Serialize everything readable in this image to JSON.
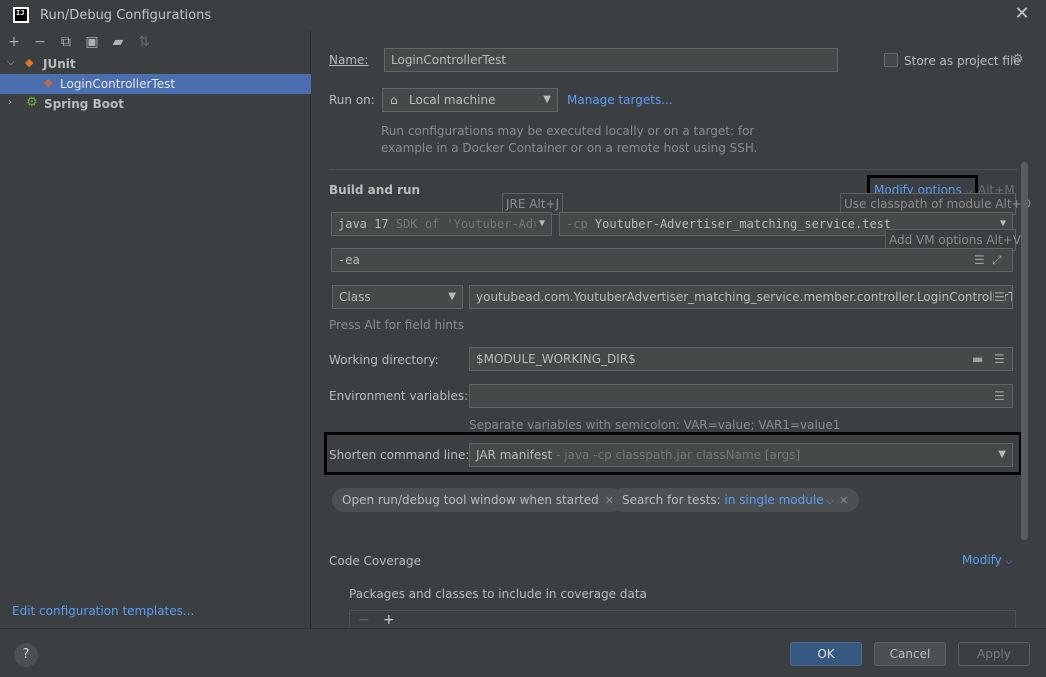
{
  "window": {
    "title": "Run/Debug Configurations",
    "app_icon_text": "IJ"
  },
  "sidebar": {
    "toolbar": [
      {
        "name": "add-icon",
        "glyph": "+"
      },
      {
        "name": "remove-icon",
        "glyph": "−"
      },
      {
        "name": "copy-icon",
        "glyph": "⧉"
      },
      {
        "name": "save-icon",
        "glyph": "▣"
      },
      {
        "name": "new-folder-icon",
        "glyph": "▰"
      },
      {
        "name": "sort-icon",
        "glyph": "⇅"
      }
    ],
    "tree": {
      "junit": {
        "label": "JUnit"
      },
      "login_test": {
        "label": "LoginControllerTest"
      },
      "spring_boot": {
        "label": "Spring Boot"
      }
    },
    "edit_templates": "Edit configuration templates..."
  },
  "form": {
    "name_label": "Name:",
    "name_value": "LoginControllerTest",
    "store_label": "Store as project file",
    "run_on_label": "Run on:",
    "run_on_value": "Local machine",
    "manage_targets": "Manage targets...",
    "run_on_hint_1": "Run configurations may be executed locally or on a target: for",
    "run_on_hint_2": "example in a Docker Container or on a remote host using SSH.",
    "build_run_title": "Build and run",
    "modify_options": "Modify options",
    "modify_shortcut": "Alt+M",
    "jre_tooltip": "JRE Alt+J",
    "use_classpath_tooltip": "Use classpath of module Alt+O",
    "add_vm_tooltip": "Add VM options Alt+V",
    "jdk_value": "java 17",
    "jdk_sdk_hint": "SDK of 'Youtuber-Adv",
    "cp_prefix": "-cp",
    "cp_value": "Youtuber-Advertiser_matching_service.test",
    "vm_options": "-ea",
    "class_kind": "Class",
    "class_value": "youtubead.com.YoutuberAdvertiser_matching_service.member.controller.LoginControllerTest",
    "alt_hint": "Press Alt for field hints",
    "working_dir_label": "Working directory:",
    "working_dir_value": "$MODULE_WORKING_DIR$",
    "env_label": "Environment variables:",
    "env_value": "",
    "env_hint": "Separate variables with semicolon: VAR=value; VAR1=value1",
    "shorten_label": "Shorten command line:",
    "shorten_value": "JAR manifest",
    "shorten_hint": " - java -cp classpath.jar className [args]",
    "tag_open_window": "Open run/debug tool window when started",
    "tag_search_prefix": "Search for tests: ",
    "tag_search_value": "in single module",
    "code_coverage_title": "Code Coverage",
    "coverage_modify": "Modify",
    "packages_label": "Packages and classes to include in coverage data"
  },
  "buttons": {
    "ok": "OK",
    "cancel": "Cancel",
    "apply": "Apply",
    "help": "?"
  },
  "colors": {
    "accent_link": "#589df6",
    "selection": "#4b6eaf",
    "background": "#3c3f41",
    "primary_button": "#365880"
  }
}
